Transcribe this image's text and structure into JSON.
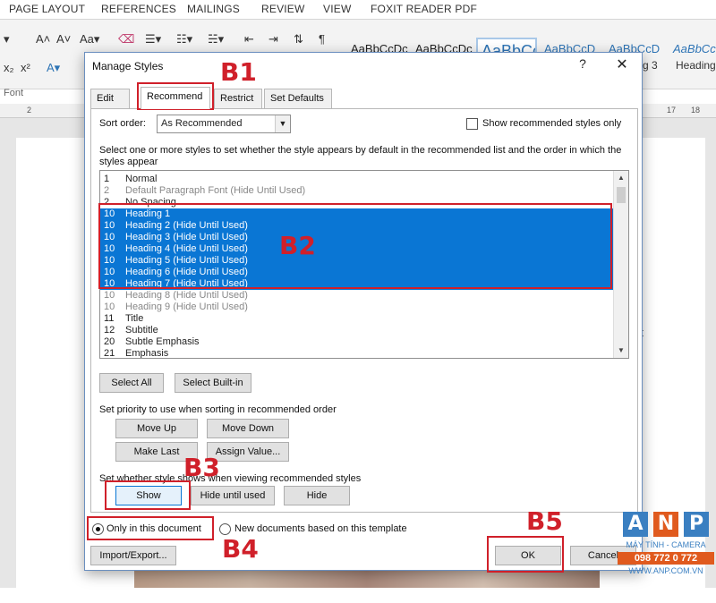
{
  "word": {
    "ribbon_tabs": [
      "PAGE LAYOUT",
      "REFERENCES",
      "MAILINGS",
      "REVIEW",
      "VIEW",
      "FOXIT READER PDF"
    ],
    "style_samples": [
      "AaBbCcDc",
      "AaBbCcDc",
      "AaBbCc",
      "AaBbCcD",
      "AaBbCcD",
      "AaBbCcD"
    ],
    "style_names": [
      "g 3",
      "Heading"
    ],
    "font_group_label": "Font",
    "ruler_left": "2",
    "ruler_right_1": "17",
    "ruler_right_2": "18",
    "body_fragments": [
      "g",
      "ệt",
      "ệ"
    ]
  },
  "dialog": {
    "title": "Manage Styles",
    "help": "?",
    "close": "✕",
    "tabs": [
      "Edit",
      "Recommend",
      "Restrict",
      "Set Defaults"
    ],
    "sort_order_label": "Sort order:",
    "sort_order_value": "As Recommended",
    "show_recommended_only": "Show recommended styles only",
    "instruction": "Select one or more styles to set whether the style appears by default in the recommended list and the order in which the styles appear",
    "styles": [
      {
        "num": "1",
        "name": "Normal",
        "state": "normal"
      },
      {
        "num": "2",
        "name": "Default Paragraph Font  (Hide Until Used)",
        "state": "dim"
      },
      {
        "num": "2",
        "name": "No Spacing",
        "state": "normal"
      },
      {
        "num": "10",
        "name": "Heading 1",
        "state": "sel"
      },
      {
        "num": "10",
        "name": "Heading 2  (Hide Until Used)",
        "state": "sel"
      },
      {
        "num": "10",
        "name": "Heading 3  (Hide Until Used)",
        "state": "sel"
      },
      {
        "num": "10",
        "name": "Heading 4  (Hide Until Used)",
        "state": "sel"
      },
      {
        "num": "10",
        "name": "Heading 5  (Hide Until Used)",
        "state": "sel"
      },
      {
        "num": "10",
        "name": "Heading 6  (Hide Until Used)",
        "state": "sel"
      },
      {
        "num": "10",
        "name": "Heading 7  (Hide Until Used)",
        "state": "sel"
      },
      {
        "num": "10",
        "name": "Heading 8  (Hide Until Used)",
        "state": "dim"
      },
      {
        "num": "10",
        "name": "Heading 9  (Hide Until Used)",
        "state": "dim"
      },
      {
        "num": "11",
        "name": "Title",
        "state": "normal"
      },
      {
        "num": "12",
        "name": "Subtitle",
        "state": "normal"
      },
      {
        "num": "20",
        "name": "Subtle Emphasis",
        "state": "normal"
      },
      {
        "num": "21",
        "name": "Emphasis",
        "state": "normal"
      }
    ],
    "select_all": "Select All",
    "select_builtin": "Select Built-in",
    "priority_label": "Set priority to use when sorting in recommended order",
    "move_up": "Move Up",
    "move_down": "Move Down",
    "make_last": "Make Last",
    "assign_value": "Assign Value...",
    "visibility_label": "Set whether style shows when viewing recommended styles",
    "show": "Show",
    "hide_until_used": "Hide until used",
    "hide": "Hide",
    "only_this_doc": "Only in this document",
    "new_docs": "New documents based on this template",
    "import_export": "Import/Export...",
    "ok": "OK",
    "cancel": "Cancel"
  },
  "annotations": {
    "b1": "B1",
    "b2": "B2",
    "b3": "B3",
    "b4": "B4",
    "b5": "B5",
    "color": "#d0202a"
  },
  "watermark": {
    "letters": [
      "A",
      "N",
      "P"
    ],
    "letter_colors": [
      "#3a7fc1",
      "#e05a1e",
      "#3a7fc1"
    ],
    "tagline": "MÁY TÍNH - CAMERA",
    "phone": "098 772 0 772",
    "website": "WWW.ANP.COM.VN"
  },
  "colors": {
    "selection": "#0a76d4",
    "dialog_border": "#6b8fbf"
  }
}
